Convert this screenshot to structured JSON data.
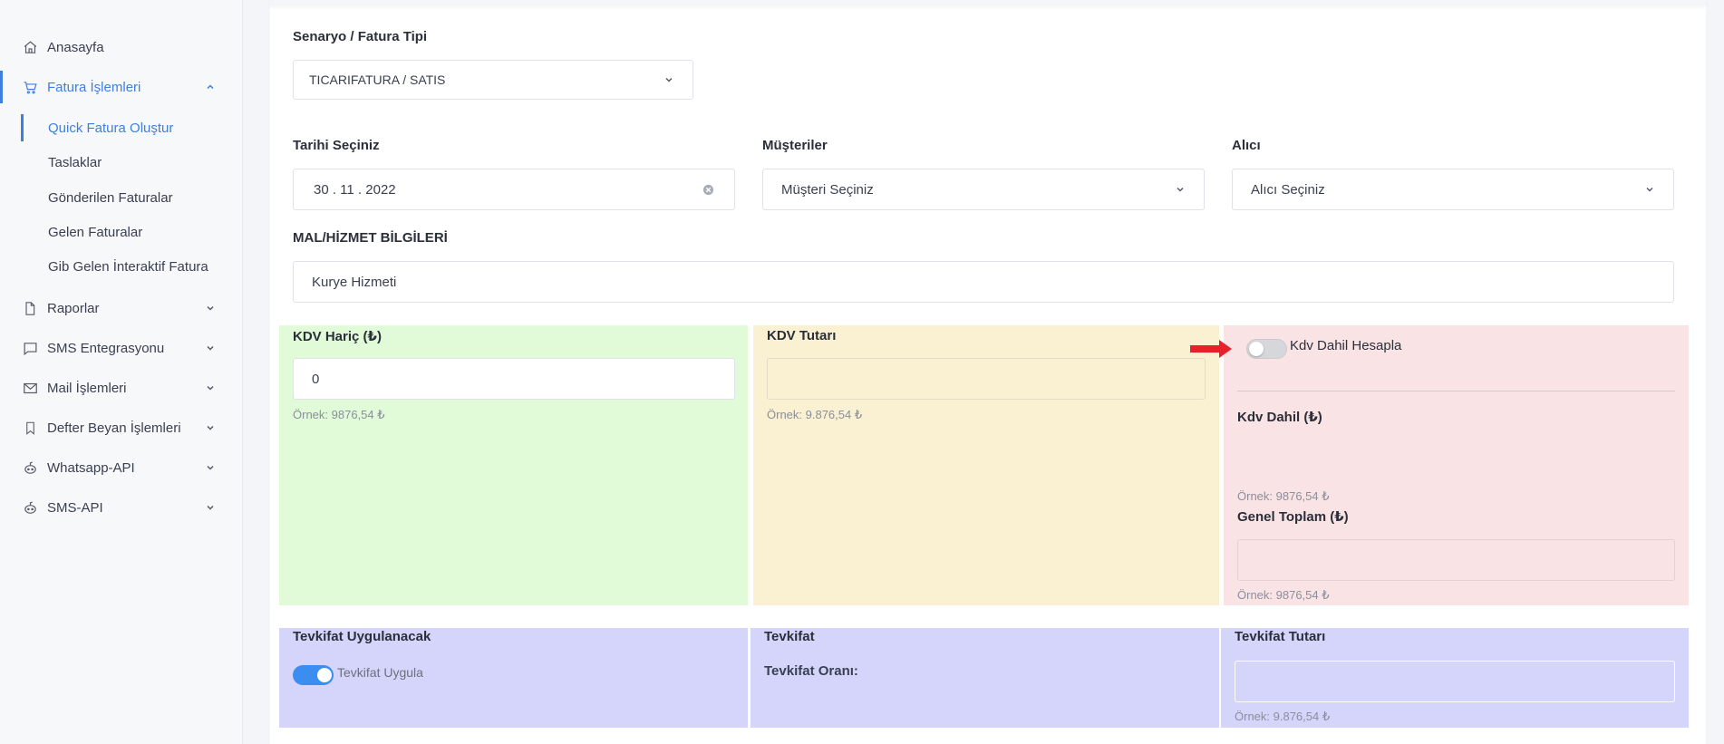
{
  "sidebar": {
    "items": [
      {
        "label": "Anasayfa",
        "icon": "home-icon"
      },
      {
        "label": "Fatura İşlemleri",
        "icon": "cart-icon"
      },
      {
        "label": "Raporlar",
        "icon": "file-icon"
      },
      {
        "label": "SMS Entegrasyonu",
        "icon": "chat-icon"
      },
      {
        "label": "Mail İşlemleri",
        "icon": "mail-icon"
      },
      {
        "label": "Defter Beyan İşlemleri",
        "icon": "bookmark-icon"
      },
      {
        "label": "Whatsapp-API",
        "icon": "robot-icon"
      },
      {
        "label": "SMS-API",
        "icon": "robot-icon"
      }
    ],
    "subitems": [
      {
        "label": "Quick Fatura Oluştur"
      },
      {
        "label": "Taslaklar"
      },
      {
        "label": "Gönderilen Faturalar"
      },
      {
        "label": "Gelen Faturalar"
      },
      {
        "label": "Gib Gelen İnteraktif Fatura"
      }
    ],
    "accent": "#3f7fe0"
  },
  "form": {
    "scenario_label": "Senaryo / Fatura Tipi",
    "scenario_value": "TICARIFATURA / SATIS",
    "date_label": "Tarihi Seçiniz",
    "date_value": "30 . 11 . 2022",
    "customers_label": "Müşteriler",
    "customers_value": "Müşteri Seçiniz",
    "receiver_label": "Alıcı",
    "receiver_value": "Alıcı Seçiniz",
    "goods_label": "MAL/HİZMET BİLGİLERİ",
    "goods_value": "Kurye Hizmeti"
  },
  "panels": {
    "kdv_haric_label": "KDV Hariç (₺)",
    "kdv_haric_value": "0",
    "kdv_haric_hint": "Örnek: 9876,54 ₺",
    "kdv_tutari_label": "KDV Tutarı",
    "kdv_tutari_hint": "Örnek: 9.876,54 ₺",
    "kdv_dahil_toggle_label": "Kdv Dahil Hesapla",
    "kdv_dahil_label": "Kdv Dahil (₺)",
    "kdv_dahil_hint": "Örnek: 9876,54 ₺",
    "genel_toplam_label": "Genel Toplam (₺)",
    "genel_toplam_hint": "Örnek: 9876,54 ₺",
    "tevkifat_uygulanacak_label": "Tevkifat Uygulanacak",
    "tevkifat_uygula_label": "Tevkifat Uygula",
    "tevkifat_label": "Tevkifat",
    "tevkifat_orani_label": "Tevkifat Oranı:",
    "tevkifat_tutari_label": "Tevkifat Tutarı",
    "tevkifat_tutari_hint": "Örnek: 9.876,54 ₺"
  },
  "colors": {
    "green": "#e1fbd8",
    "yellow": "#faf0d2",
    "pink": "#fae3e4",
    "violet": "#d5d5fc",
    "toggle_on": "#3b8ef0",
    "arrow": "#e8202a"
  }
}
